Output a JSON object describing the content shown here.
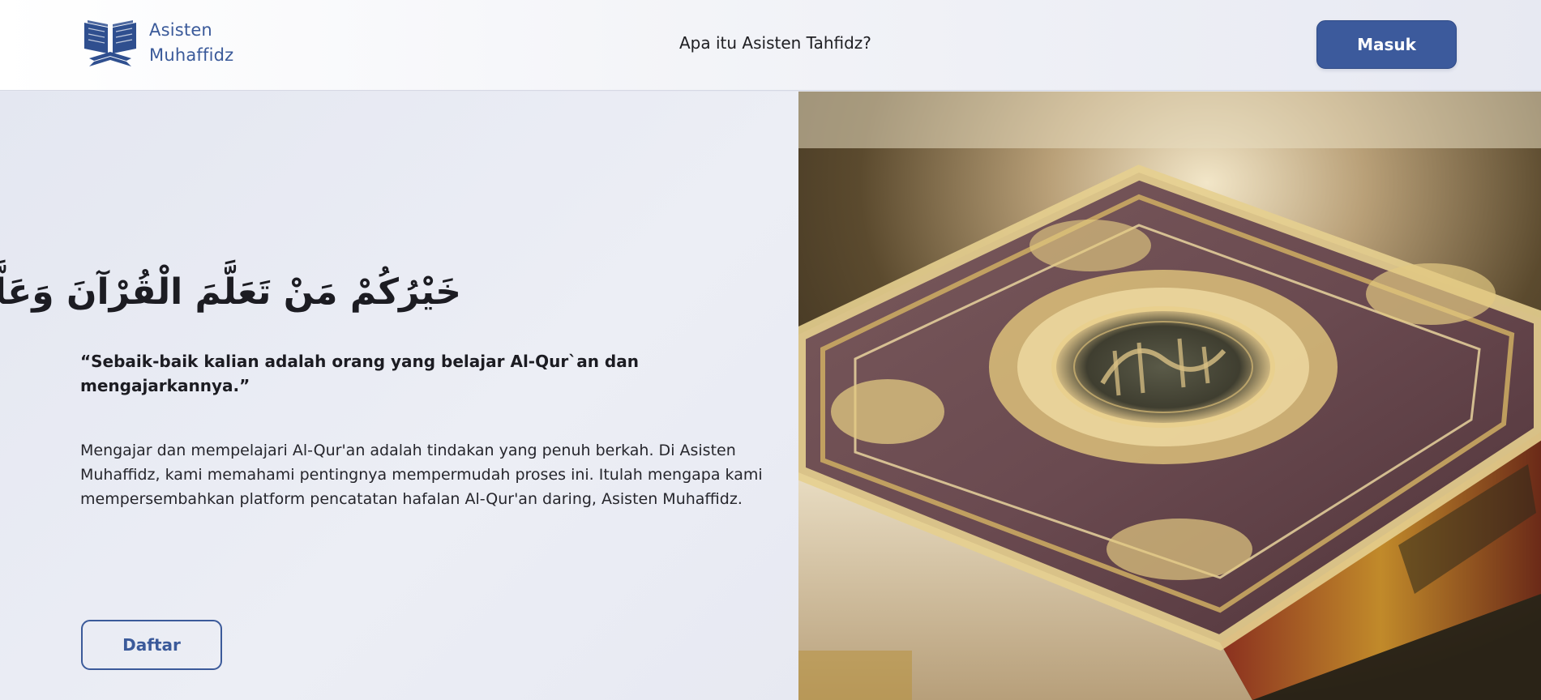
{
  "navbar": {
    "brand_line1": "Asisten",
    "brand_line2": "Muhaffidz",
    "logo_icon": "open-quran-book-icon",
    "nav_link": "Apa itu Asisten Tahfidz?",
    "login_label": "Masuk"
  },
  "hero": {
    "arabic_verse": "خَيْرُكُمْ مَنْ تَعَلَّمَ الْقُرْآنَ وَعَلَّمَهُ",
    "quote": "“Sebaik-baik kalian adalah orang yang belajar Al-Qur`an dan mengajarkannya.”",
    "description": "Mengajar dan mempelajari Al-Qur'an adalah tindakan yang penuh berkah. Di Asisten Muhaffidz, kami memahami pentingnya mempermudah proses ini. Itulah mengapa kami mempersembahkan platform pencatatan hafalan Al-Qur'an daring, Asisten Muhaffidz.",
    "register_label": "Daftar",
    "image": "quran-book-photo"
  },
  "colors": {
    "brand_blue": "#3c5a9c",
    "background": "#e6e8f1",
    "text": "#1c1c22"
  }
}
